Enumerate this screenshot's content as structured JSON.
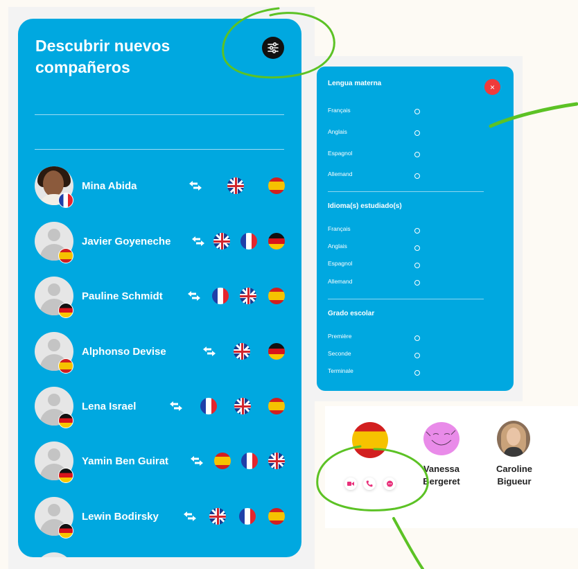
{
  "panel": {
    "title": "Descubrir nuevos compañeros",
    "filter_icon": "sliders-icon"
  },
  "users": [
    {
      "name": "Mina Abida",
      "native_flag": "fr",
      "learn_flags": [
        "uk",
        "es"
      ],
      "has_photo": true
    },
    {
      "name": "Javier Goyeneche",
      "native_flag": "es",
      "learn_flags": [
        "uk",
        "fr",
        "de"
      ],
      "has_photo": false
    },
    {
      "name": "Pauline Schmidt",
      "native_flag": "de",
      "learn_flags": [
        "fr",
        "uk",
        "es"
      ],
      "has_photo": false
    },
    {
      "name": "Alphonso Devise",
      "native_flag": "es",
      "learn_flags": [
        "uk",
        "de"
      ],
      "has_photo": false
    },
    {
      "name": "Lena Israel",
      "native_flag": "de",
      "learn_flags": [
        "fr",
        "uk",
        "es"
      ],
      "has_photo": false
    },
    {
      "name": "Yamin Ben Guirat",
      "native_flag": "de",
      "learn_flags": [
        "es",
        "fr",
        "uk"
      ],
      "has_photo": false
    },
    {
      "name": "Lewin Bodirsky",
      "native_flag": "de",
      "learn_flags": [
        "uk",
        "fr",
        "es"
      ],
      "has_photo": false
    }
  ],
  "filter": {
    "close_label": "×",
    "native": {
      "title": "Lengua materna",
      "options": [
        "Français",
        "Anglais",
        "Espagnol",
        "Allemand"
      ]
    },
    "studied": {
      "title": "Idioma(s) estudiado(s)",
      "options": [
        "Français",
        "Anglais",
        "Espagnol",
        "Allemand"
      ]
    },
    "grade": {
      "title": "Grado escolar",
      "options": [
        "Première",
        "Seconde",
        "Terminale"
      ]
    }
  },
  "profiles": [
    {
      "name_line1": "Vanessa",
      "name_line2": "Bergeret"
    },
    {
      "name_line1": "Caroline",
      "name_line2": "Bigueur"
    }
  ],
  "actions": [
    "video-icon",
    "phone-icon",
    "chat-icon"
  ],
  "colors": {
    "panel": "#00a8e0",
    "accent_pink": "#e8307a",
    "close_red": "#ef3b3b",
    "annotation_green": "#5cc225"
  }
}
